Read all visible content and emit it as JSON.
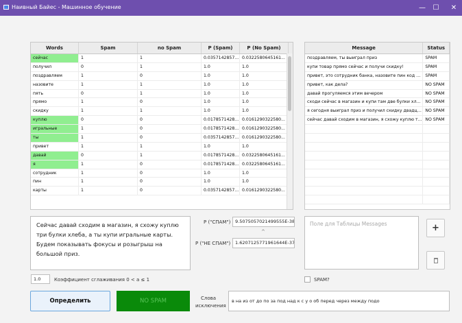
{
  "window": {
    "title": "Наивный Байес - Машинное обучение",
    "minimize": "—",
    "maximize": "☐",
    "close": "✕"
  },
  "words_table": {
    "columns": [
      "Words",
      "Spam",
      "no Spam",
      "P (Spam)",
      "P (No Spam)"
    ],
    "rows": [
      {
        "word": "сейчас",
        "spam": "1",
        "nospam": "1",
        "pspam": "0.0357142857...",
        "pnospam": "0.0322580645161...",
        "highlight": true
      },
      {
        "word": "получил",
        "spam": "0",
        "nospam": "1",
        "pspam": "1.0",
        "pnospam": "1.0",
        "highlight": false
      },
      {
        "word": "поздравляем",
        "spam": "1",
        "nospam": "0",
        "pspam": "1.0",
        "pnospam": "1.0",
        "highlight": false
      },
      {
        "word": "назовите",
        "spam": "1",
        "nospam": "1",
        "pspam": "1.0",
        "pnospam": "1.0",
        "highlight": false
      },
      {
        "word": "пять",
        "spam": "0",
        "nospam": "1",
        "pspam": "1.0",
        "pnospam": "1.0",
        "highlight": false
      },
      {
        "word": "прямо",
        "spam": "1",
        "nospam": "0",
        "pspam": "1.0",
        "pnospam": "1.0",
        "highlight": false
      },
      {
        "word": "скидку",
        "spam": "1",
        "nospam": "1",
        "pspam": "1.0",
        "pnospam": "1.0",
        "highlight": false
      },
      {
        "word": "куплю",
        "spam": "0",
        "nospam": "0",
        "pspam": "0.0178571428...",
        "pnospam": "0.0161290322580...",
        "highlight": true
      },
      {
        "word": "игральные",
        "spam": "1",
        "nospam": "0",
        "pspam": "0.0178571428...",
        "pnospam": "0.0161290322580...",
        "highlight": true
      },
      {
        "word": "ты",
        "spam": "1",
        "nospam": "0",
        "pspam": "0.0357142857...",
        "pnospam": "0.0161290322580...",
        "highlight": true
      },
      {
        "word": "привет",
        "spam": "1",
        "nospam": "1",
        "pspam": "1.0",
        "pnospam": "1.0",
        "highlight": false
      },
      {
        "word": "давай",
        "spam": "0",
        "nospam": "1",
        "pspam": "0.0178571428...",
        "pnospam": "0.0322580645161...",
        "highlight": true
      },
      {
        "word": "я",
        "spam": "1",
        "nospam": "0",
        "pspam": "0.0178571428...",
        "pnospam": "0.0322580645161...",
        "highlight": true
      },
      {
        "word": "сотрудник",
        "spam": "1",
        "nospam": "0",
        "pspam": "1.0",
        "pnospam": "1.0",
        "highlight": false
      },
      {
        "word": "пин",
        "spam": "1",
        "nospam": "0",
        "pspam": "1.0",
        "pnospam": "1.0",
        "highlight": false
      },
      {
        "word": "карты",
        "spam": "1",
        "nospam": "0",
        "pspam": "0.0357142857...",
        "pnospam": "0.0161290322580...",
        "highlight": false
      }
    ]
  },
  "messages_table": {
    "columns": [
      "Message",
      "Status"
    ],
    "rows": [
      {
        "message": "поздравляем, ты выиграл приз",
        "status": "SPAM"
      },
      {
        "message": "купи товар прямо сейчас и получи скидку!",
        "status": "SPAM"
      },
      {
        "message": "привет, это сотрудник банка, назовите пин код к...",
        "status": "SPAM"
      },
      {
        "message": "привет, как дела?",
        "status": "NO SPAM"
      },
      {
        "message": "давай прогуляемся этим вечером",
        "status": "NO SPAM"
      },
      {
        "message": "сходи сейчас в магазин и купи там две булки хле...",
        "status": "NO SPAM"
      },
      {
        "message": "я сегодня выиграл приз и получил скидку двадца...",
        "status": "NO SPAM"
      },
      {
        "message": "сейчас давай сходим в магазин, я схожу куплю т...",
        "status": "NO SPAM"
      }
    ]
  },
  "input": {
    "message_text": "Сейчас давай сходим в магазин, я схожу куплю три булки хлеба, а ты купи игральные карты. Будем показывать фокусы и розыгрыш на большой приз."
  },
  "probabilities": {
    "p_spam_label": "P (\"СПАМ\")",
    "p_spam_value": "9.5075057021499555E-38",
    "p_nospam_label": "P (\"НЕ СПАМ\")",
    "p_nospam_value": "1.6207125771961644E-37",
    "compare_sign": "^"
  },
  "new_message": {
    "placeholder": "Поле для Таблицы Messages",
    "add_label": "+",
    "delete_label": "🗑",
    "spam_checkbox_label": "SPAM?"
  },
  "smoothing": {
    "value": "1.0",
    "label": "Коэффициент сглаживания 0 < a ≤ 1"
  },
  "actions": {
    "determine_label": "Определить",
    "result_label": "NO SPAM",
    "result_color": "#0a8a0a"
  },
  "stopwords": {
    "label": "Слова исключения",
    "value": "в на из от до по за под над к с у о об перед через между подо"
  },
  "colors": {
    "titlebar": "#6e4fae",
    "highlight": "#90ee90"
  }
}
